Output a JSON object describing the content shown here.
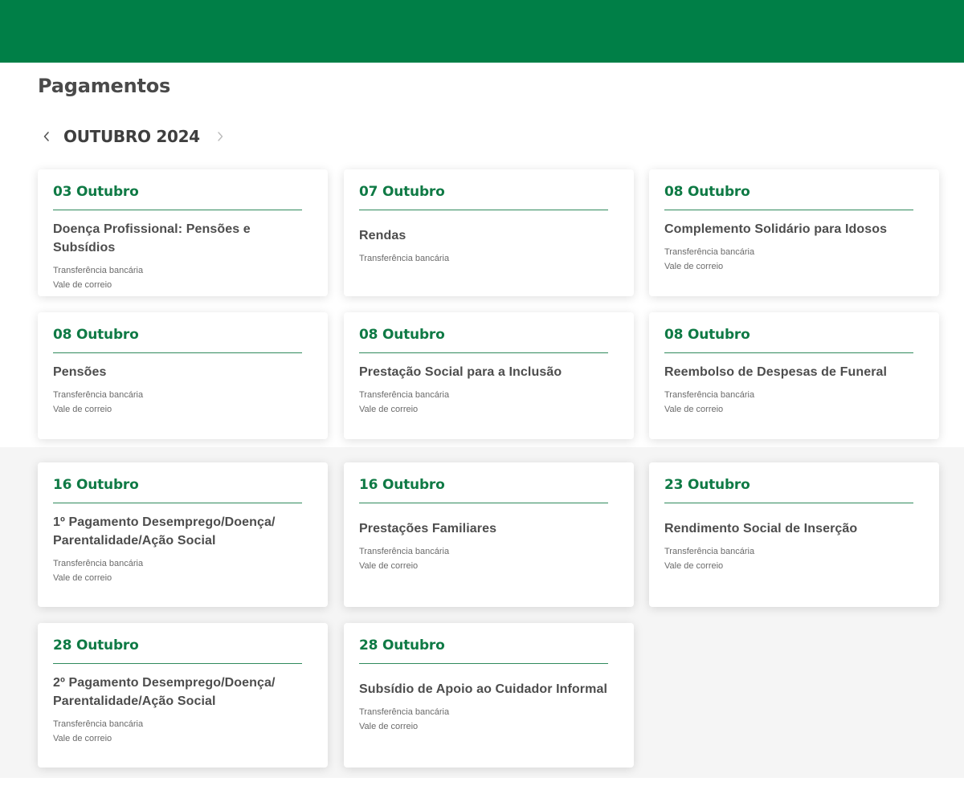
{
  "page": {
    "title": "Pagamentos"
  },
  "calendar": {
    "month_label": "OUTUBRO 2024",
    "prev_icon": "chevron-left-icon",
    "next_icon": "chevron-right-icon"
  },
  "colors": {
    "header": "#007f47",
    "date": "#0f7a45"
  },
  "payments": [
    {
      "date": "03 Outubro",
      "title": "Doença Profissional: Pensões e Subsídios",
      "methods": [
        "Transferência bancária",
        "Vale de correio"
      ]
    },
    {
      "date": "07 Outubro",
      "title": "Rendas",
      "methods": [
        "Transferência bancária"
      ]
    },
    {
      "date": "08 Outubro",
      "title": "Complemento Solidário para Idosos",
      "methods": [
        "Transferência bancária",
        "Vale de correio"
      ]
    },
    {
      "date": "08 Outubro",
      "title": "Pensões",
      "methods": [
        "Transferência bancária",
        "Vale de correio"
      ]
    },
    {
      "date": "08 Outubro",
      "title": "Prestação Social para a Inclusão",
      "methods": [
        "Transferência bancária",
        "Vale de correio"
      ]
    },
    {
      "date": "08 Outubro",
      "title": "Reembolso de Despesas de Funeral",
      "methods": [
        "Transferência bancária",
        "Vale de correio"
      ]
    },
    {
      "date": "16 Outubro",
      "title": "1º Pagamento Desemprego/Doença/ Parentalidade/Ação Social",
      "methods": [
        "Transferência bancária",
        "Vale de correio"
      ]
    },
    {
      "date": "16 Outubro",
      "title": "Prestações Familiares",
      "methods": [
        "Transferência bancária",
        "Vale de correio"
      ]
    },
    {
      "date": "23 Outubro",
      "title": "Rendimento Social de Inserção",
      "methods": [
        "Transferência bancária",
        "Vale de correio"
      ]
    },
    {
      "date": "28 Outubro",
      "title": "2º Pagamento Desemprego/Doença/ Parentalidade/Ação Social",
      "methods": [
        "Transferência bancária",
        "Vale de correio"
      ]
    },
    {
      "date": "28 Outubro",
      "title": "Subsídio de Apoio ao Cuidador Informal",
      "methods": [
        "Transferência bancária",
        "Vale de correio"
      ]
    }
  ]
}
